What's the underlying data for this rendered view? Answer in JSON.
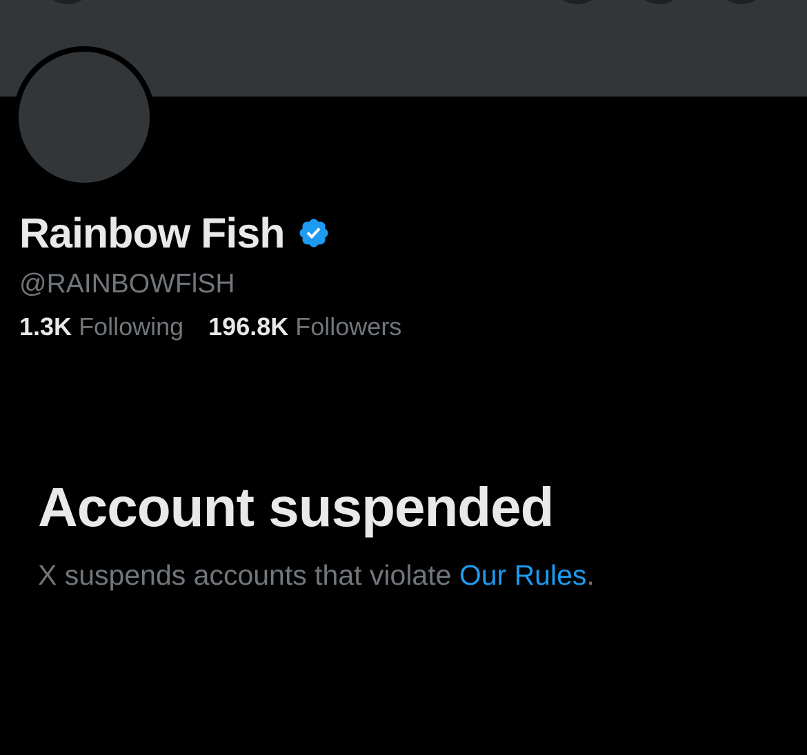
{
  "profile": {
    "display_name": "Rainbow Fish",
    "handle": "@RAINBOWFlSH",
    "verified": true,
    "stats": {
      "following_count": "1.3K",
      "following_label": "Following",
      "followers_count": "196.8K",
      "followers_label": "Followers"
    }
  },
  "suspension": {
    "title": "Account suspended",
    "message_prefix": "X suspends accounts that violate ",
    "link_text": "Our Rules",
    "message_suffix": "."
  },
  "colors": {
    "background": "#000000",
    "banner": "#333639",
    "primary_text": "#e7e9ea",
    "secondary_text": "#71767b",
    "accent_blue": "#1d9bf0"
  }
}
